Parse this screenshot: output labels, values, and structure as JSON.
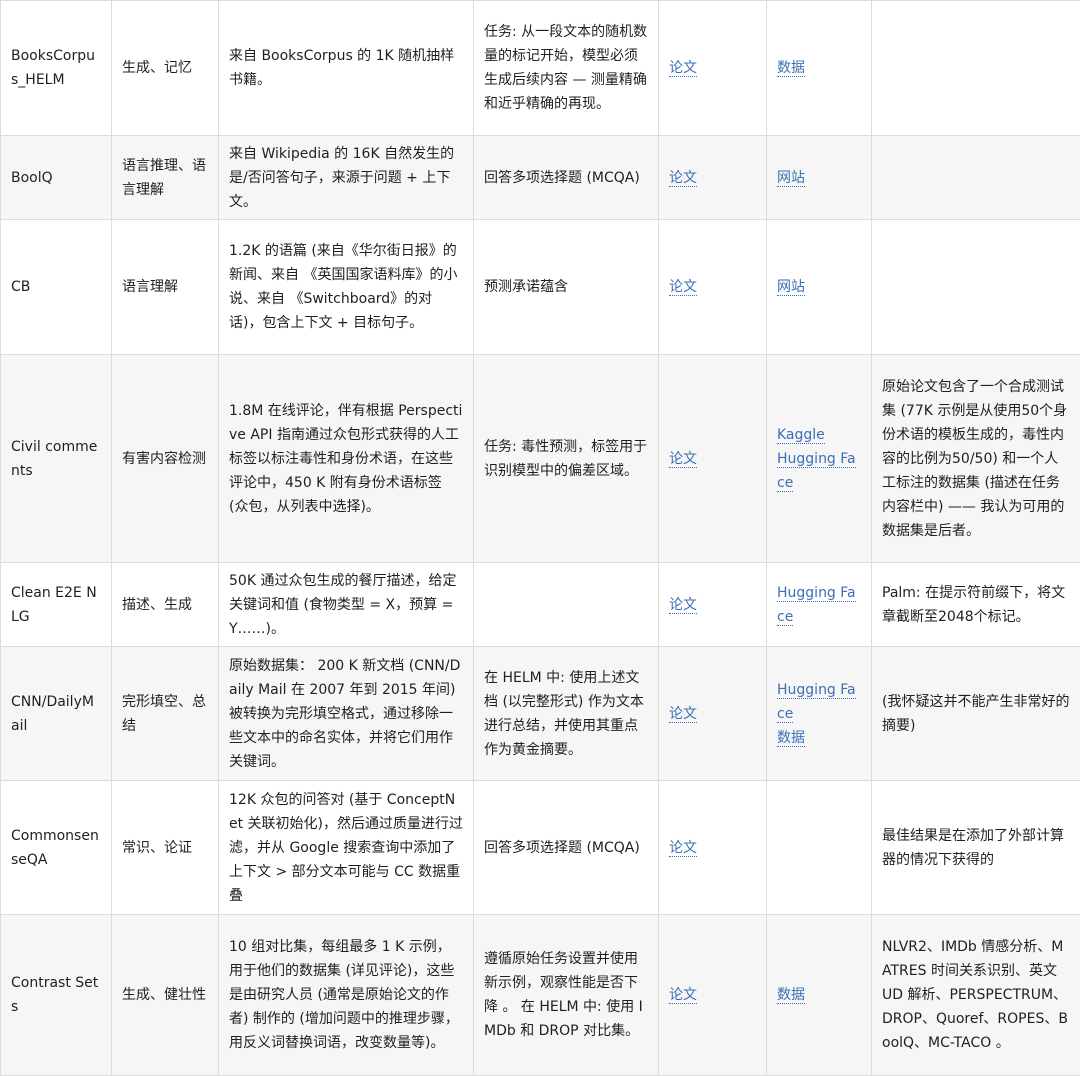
{
  "rows": [
    {
      "name": "BooksCorpus_HELM",
      "category": "生成、记忆",
      "description": "来自 BooksCorpus 的 1K 随机抽样书籍。",
      "task": "任务: 从一段文本的随机数量的标记开始，模型必须生成后续内容 — 测量精确和近乎精确的再现。",
      "paper": "论文",
      "resources": [
        "数据"
      ],
      "notes": ""
    },
    {
      "name": "BoolQ",
      "category": "语言推理、语言理解",
      "description": "来自 Wikipedia 的 16K 自然发生的是/否问答句子，来源于问题 + 上下文。",
      "task": "回答多项选择题 (MCQA)",
      "paper": "论文",
      "resources": [
        "网站"
      ],
      "notes": ""
    },
    {
      "name": "CB",
      "category": "语言理解",
      "description": "1.2K 的语篇 (来自《华尔街日报》的新闻、来自 《英国国家语料库》的小说、来自 《Switchboard》的对话)，包含上下文 + 目标句子。",
      "task": "预测承诺蕴含",
      "paper": "论文",
      "resources": [
        "网站"
      ],
      "notes": ""
    },
    {
      "name": "Civil comments",
      "category": "有害内容检测",
      "description": "1.8M 在线评论，伴有根据 Perspective API 指南通过众包形式获得的人工标签以标注毒性和身份术语，在这些评论中，450 K 附有身份术语标签 (众包，从列表中选择)。",
      "task": "任务: 毒性预测，标签用于识别模型中的偏差区域。",
      "paper": "论文",
      "resources": [
        "Kaggle",
        "Hugging Face"
      ],
      "notes": "原始论文包含了一个合成测试集 (77K 示例是从使用50个身份术语的模板生成的，毒性内容的比例为50/50) 和一个人工标注的数据集 (描述在任务内容栏中) —— 我认为可用的数据集是后者。"
    },
    {
      "name": "Clean E2E NLG",
      "category": "描述、生成",
      "description": "50K 通过众包生成的餐厅描述，给定关键词和值 (食物类型 = X，预算 = Y……)。",
      "task": "",
      "paper": "论文",
      "resources": [
        "Hugging Face"
      ],
      "notes": "Palm: 在提示符前缀下，将文章截断至2048个标记。"
    },
    {
      "name": "CNN/DailyMail",
      "category": "完形填空、总结",
      "description": "原始数据集： 200 K 新文档 (CNN/Daily Mail 在 2007 年到 2015 年间) 被转换为完形填空格式，通过移除一些文本中的命名实体，并将它们用作关键词。",
      "task": "在 HELM 中: 使用上述文档 (以完整形式) 作为文本进行总结，并使用其重点作为黄金摘要。",
      "paper": "论文",
      "resources": [
        "Hugging Face",
        "数据"
      ],
      "notes": "(我怀疑这并不能产生非常好的摘要)"
    },
    {
      "name": "CommonsenseQA",
      "category": "常识、论证",
      "description": "12K 众包的问答对 (基于 ConceptNet 关联初始化)，然后通过质量进行过滤，并从 Google 搜索查询中添加了上下文 > 部分文本可能与 CC 数据重叠",
      "task": "回答多项选择题 (MCQA)",
      "paper": "论文",
      "resources": [],
      "notes": "最佳结果是在添加了外部计算器的情况下获得的"
    },
    {
      "name": "Contrast Sets",
      "category": "生成、健壮性",
      "description": "10 组对比集，每组最多 1 K 示例，用于他们的数据集 (详见评论)，这些是由研究人员 (通常是原始论文的作者) 制作的 (增加问题中的推理步骤，用反义词替换词语，改变数量等)。",
      "task": "遵循原始任务设置并使用新示例，观察性能是否下降 。 在 HELM 中: 使用 IMDb 和 DROP 对比集。",
      "paper": "论文",
      "resources": [
        "数据"
      ],
      "notes": "NLVR2、IMDb 情感分析、MATRES 时间关系识别、英文 UD 解析、PERSPECTRUM、DROP、Quoref、ROPES、BoolQ、MC-TACO 。"
    }
  ]
}
